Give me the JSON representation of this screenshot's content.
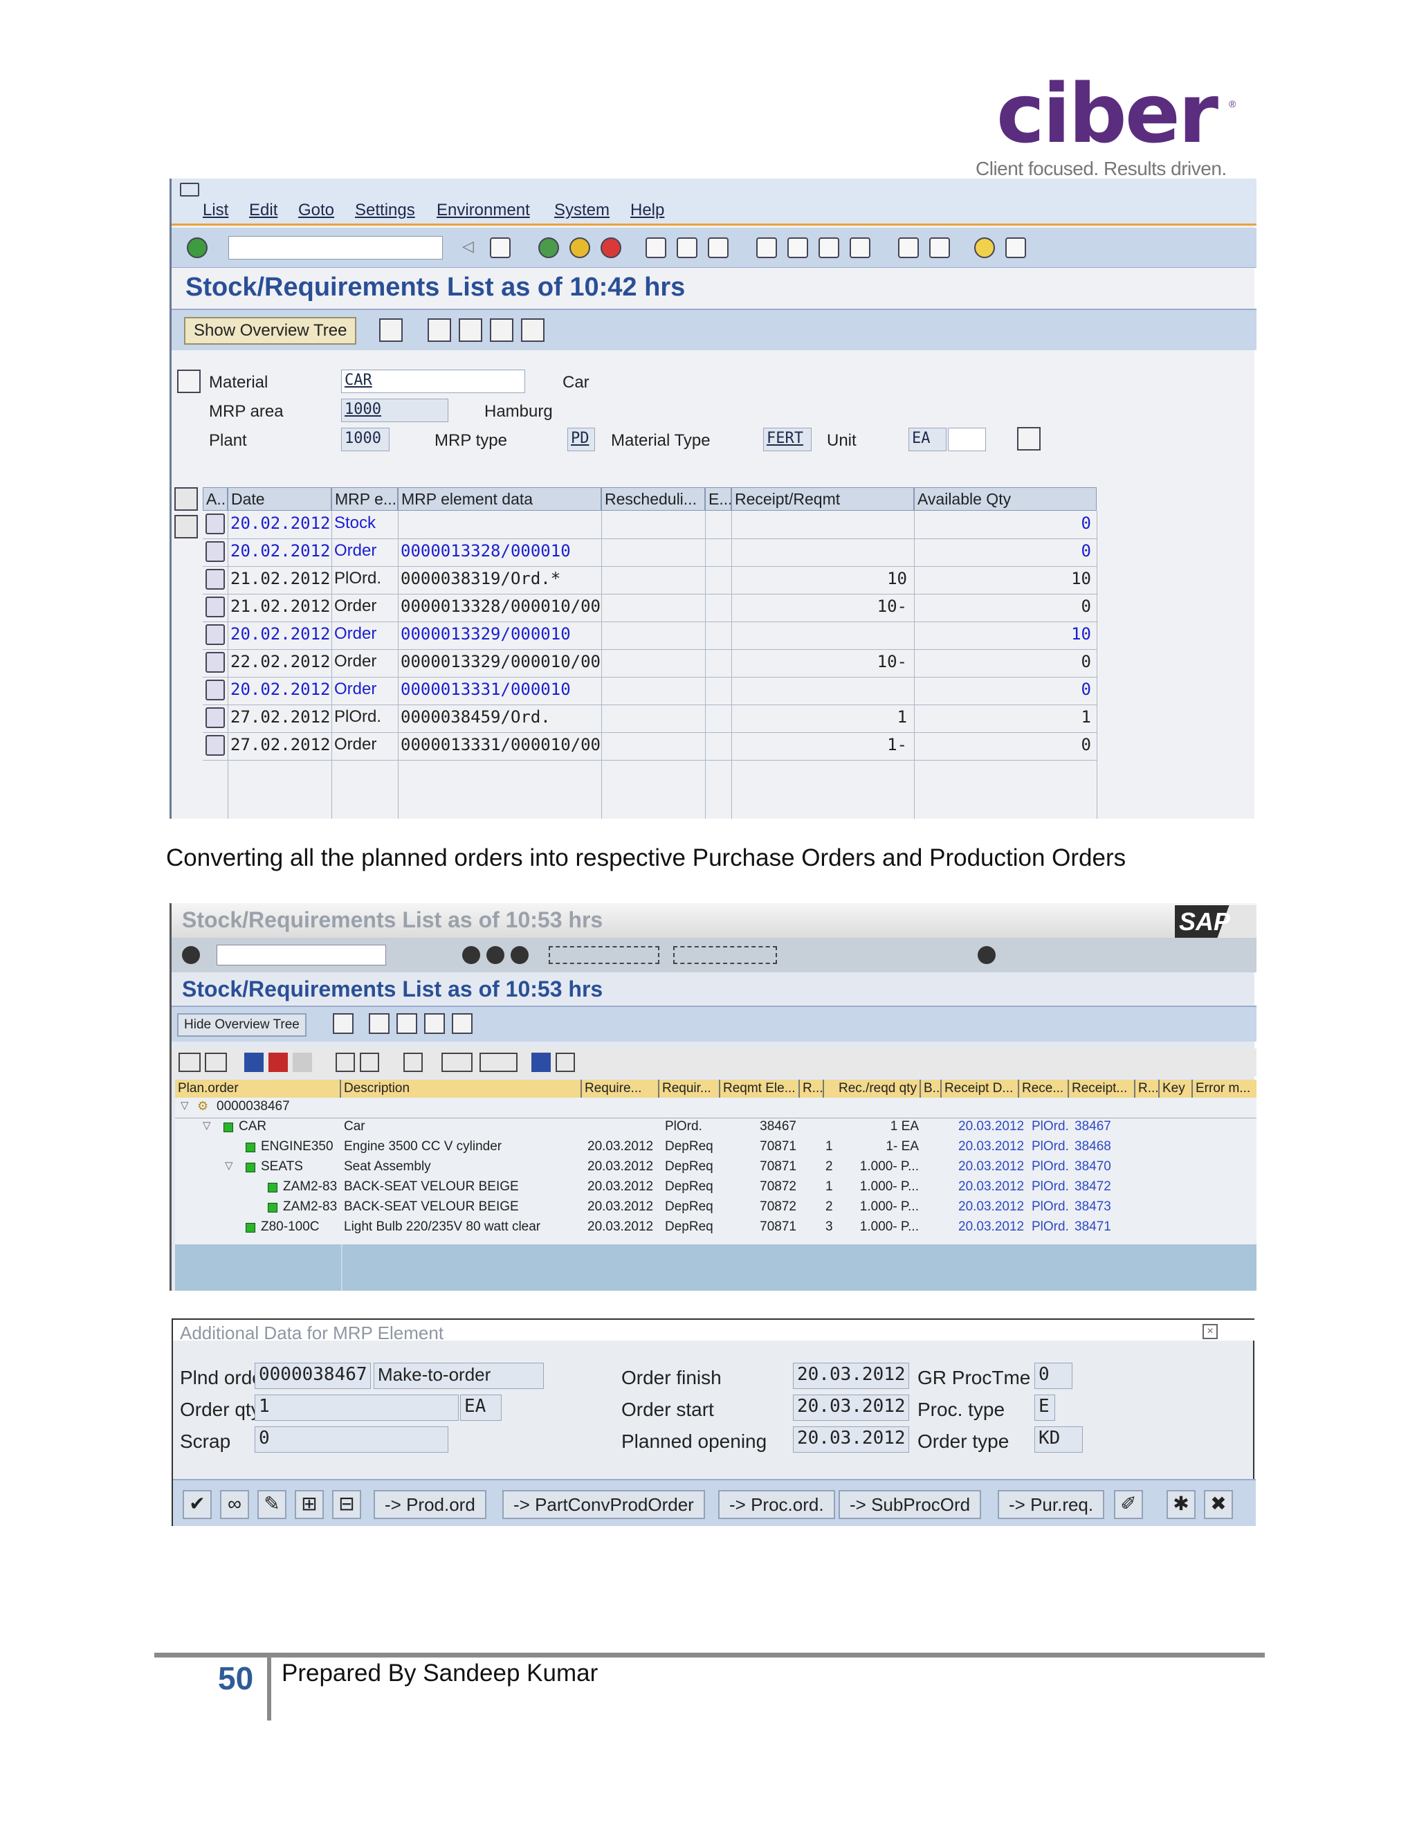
{
  "logo": {
    "word": "ciber",
    "reg": "®",
    "tagline": "Client focused. Results driven."
  },
  "screen1": {
    "menu": [
      "List",
      "Edit",
      "Goto",
      "Settings",
      "Environment",
      "System",
      "Help"
    ],
    "title": "Stock/Requirements List as of 10:42 hrs",
    "overview_button": "Show Overview Tree",
    "fields": {
      "material_label": "Material",
      "material_value": "CAR",
      "material_desc": "Car",
      "mrp_area_label": "MRP area",
      "mrp_area_value": "1000",
      "mrp_area_desc": "Hamburg",
      "plant_label": "Plant",
      "plant_value": "1000",
      "mrp_type_label": "MRP type",
      "mrp_type_value": "PD",
      "material_type_label": "Material Type",
      "material_type_value": "FERT",
      "unit_label": "Unit",
      "unit_value": "EA"
    },
    "columns": [
      "A...",
      "Date",
      "MRP e...",
      "MRP element data",
      "Rescheduli...",
      "E...",
      "Receipt/Reqmt",
      "Available Qty"
    ],
    "rows": [
      {
        "date": "20.02.2012",
        "mrp": "Stock",
        "data": "",
        "receipt": "",
        "avail": "0",
        "blue": true
      },
      {
        "date": "20.02.2012",
        "mrp": "Order",
        "data": "0000013328/000010",
        "receipt": "",
        "avail": "0",
        "blue": true
      },
      {
        "date": "21.02.2012",
        "mrp": "PlOrd.",
        "data": "0000038319/Ord.*",
        "receipt": "10",
        "avail": "10",
        "blue": false
      },
      {
        "date": "21.02.2012",
        "mrp": "Order",
        "data": "0000013328/000010/000",
        "receipt": "10-",
        "avail": "0",
        "blue": false
      },
      {
        "date": "20.02.2012",
        "mrp": "Order",
        "data": "0000013329/000010",
        "receipt": "",
        "avail": "10",
        "blue": true
      },
      {
        "date": "22.02.2012",
        "mrp": "Order",
        "data": "0000013329/000010/000",
        "receipt": "10-",
        "avail": "0",
        "blue": false
      },
      {
        "date": "20.02.2012",
        "mrp": "Order",
        "data": "0000013331/000010",
        "receipt": "",
        "avail": "0",
        "blue": true
      },
      {
        "date": "27.02.2012",
        "mrp": "PlOrd.",
        "data": "0000038459/Ord.",
        "receipt": "1",
        "avail": "1",
        "blue": false
      },
      {
        "date": "27.02.2012",
        "mrp": "Order",
        "data": "0000013331/000010/000",
        "receipt": "1-",
        "avail": "0",
        "blue": false
      }
    ]
  },
  "caption": "Converting all the planned orders into respective Purchase Orders and Production Orders",
  "screen2": {
    "faded_title": "Stock/Requirements List as of 10:53 hrs",
    "title": "Stock/Requirements List as of 10:53 hrs",
    "sap_logo": "SAP",
    "overview_button": "Hide Overview Tree",
    "columns": [
      "Plan.order",
      "Description",
      "Require...",
      "Requir...",
      "Reqmt Ele...",
      "R...",
      "Rec./reqd qty",
      "B...",
      "Receipt D...",
      "Rece...",
      "Receipt...",
      "R...",
      "Key",
      "Error m..."
    ],
    "tree": [
      {
        "indent": 0,
        "icon": "tree",
        "node": "0000038467",
        "desc": "",
        "req": "",
        "reqr": "",
        "ele": "",
        "r": "",
        "qty": "",
        "date": "",
        "rece": "",
        "receipt": ""
      },
      {
        "indent": 1,
        "icon": "sq",
        "node": "CAR",
        "desc": "Car",
        "req": "",
        "reqr": "PlOrd.",
        "ele": "38467",
        "r": "",
        "qty": "1 EA",
        "date": "20.03.2012",
        "rece": "PlOrd.",
        "receipt": "38467"
      },
      {
        "indent": 2,
        "icon": "sq",
        "node": "ENGINE350",
        "desc": "Engine 3500 CC V cylinder",
        "req": "20.03.2012",
        "reqr": "DepReq",
        "ele": "70871",
        "r": "1",
        "qty": "1- EA",
        "date": "20.03.2012",
        "rece": "PlOrd.",
        "receipt": "38468"
      },
      {
        "indent": 2,
        "icon": "sq",
        "node": "SEATS",
        "desc": "Seat Assembly",
        "req": "20.03.2012",
        "reqr": "DepReq",
        "ele": "70871",
        "r": "2",
        "qty": "1.000- P...",
        "date": "20.03.2012",
        "rece": "PlOrd.",
        "receipt": "38470"
      },
      {
        "indent": 3,
        "icon": "sq",
        "node": "ZAM2-83",
        "desc": "BACK-SEAT VELOUR BEIGE",
        "req": "20.03.2012",
        "reqr": "DepReq",
        "ele": "70872",
        "r": "1",
        "qty": "1.000- P...",
        "date": "20.03.2012",
        "rece": "PlOrd.",
        "receipt": "38472"
      },
      {
        "indent": 3,
        "icon": "sq",
        "node": "ZAM2-83",
        "desc": "BACK-SEAT VELOUR BEIGE",
        "req": "20.03.2012",
        "reqr": "DepReq",
        "ele": "70872",
        "r": "2",
        "qty": "1.000- P...",
        "date": "20.03.2012",
        "rece": "PlOrd.",
        "receipt": "38473"
      },
      {
        "indent": 2,
        "icon": "sq",
        "node": "Z80-100C",
        "desc": "Light Bulb 220/235V 80 watt clear",
        "req": "20.03.2012",
        "reqr": "DepReq",
        "ele": "70871",
        "r": "3",
        "qty": "1.000- P...",
        "date": "20.03.2012",
        "rece": "PlOrd.",
        "receipt": "38471"
      }
    ]
  },
  "dialog": {
    "title": "Additional Data for MRP Element",
    "close": "×",
    "plnd_order_label": "Plnd order",
    "plnd_order_value": "0000038467",
    "plnd_order_kind": "Make-to-order",
    "order_qty_label": "Order qty",
    "order_qty_value": "1",
    "order_qty_unit": "EA",
    "scrap_label": "Scrap",
    "scrap_value": "0",
    "order_finish_label": "Order finish",
    "order_finish_value": "20.03.2012",
    "order_start_label": "Order start",
    "order_start_value": "20.03.2012",
    "planned_opening_label": "Planned opening",
    "planned_opening_value": "20.03.2012",
    "gr_proc_label": "GR ProcTme",
    "gr_proc_value": "0",
    "proc_type_label": "Proc. type",
    "proc_type_value": "E",
    "order_type_label": "Order type",
    "order_type_value": "KD",
    "buttons": [
      "-> Prod.ord",
      "-> PartConvProdOrder",
      "-> Proc.ord.",
      "-> SubProcOrd",
      "-> Pur.req."
    ]
  },
  "footer": {
    "page": "50",
    "text": "Prepared By Sandeep Kumar"
  }
}
